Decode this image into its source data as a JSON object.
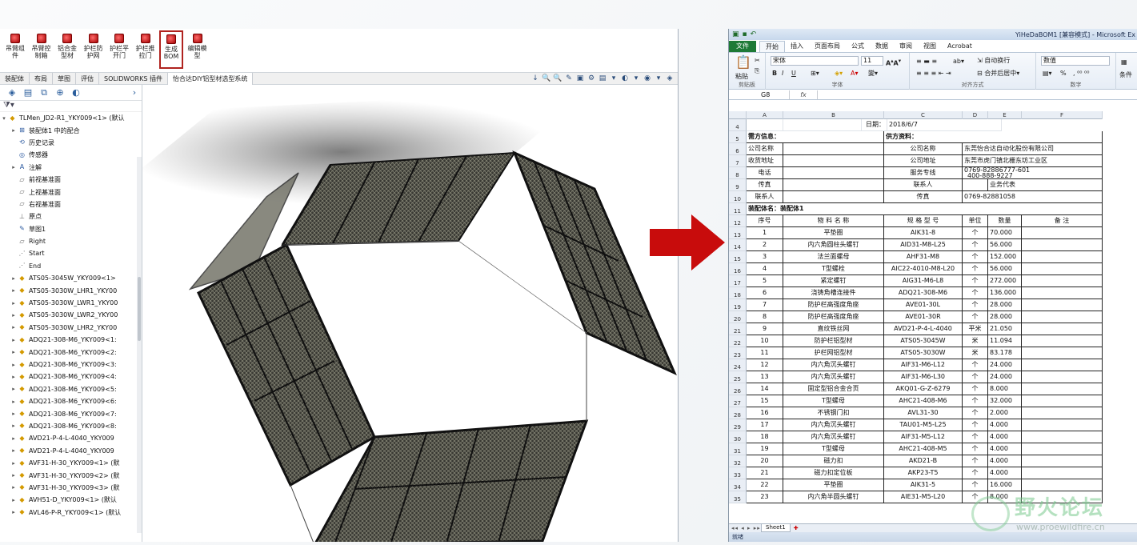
{
  "solidworks": {
    "commands": [
      {
        "label": "吊臂组件",
        "active": false
      },
      {
        "label": "吊臂控制箱",
        "active": false
      },
      {
        "label": "铝合金型材",
        "active": false
      },
      {
        "label": "护栏防护网",
        "active": false
      },
      {
        "label": "护栏平开门",
        "active": false
      },
      {
        "label": "护栏推拉门",
        "active": false
      },
      {
        "label": "生成BOM",
        "active": true
      },
      {
        "label": "编辑模型",
        "active": false
      }
    ],
    "tabs": [
      "装配体",
      "布局",
      "草图",
      "评估",
      "SOLIDWORKS 插件",
      "怡合达DIY铝型材选型系统"
    ],
    "active_tab": "怡合达DIY铝型材选型系统",
    "view_tools": [
      "↓",
      "🔍",
      "🔍",
      "✎",
      "▣",
      "⚙",
      "▤",
      "▾",
      "◐",
      "▾",
      "◉",
      "▾",
      "◈"
    ],
    "tree_tabs": [
      "assembly-icon",
      "property-icon",
      "config-icon",
      "target-icon",
      "display-icon"
    ],
    "tree": [
      {
        "label": "TLMen_JD2-R1_YKY009<1> (默认",
        "icon": "assembly",
        "arrow": "▾"
      },
      {
        "label": "装配体1 中的配合",
        "icon": "mates",
        "arrow": "▸"
      },
      {
        "label": "历史记录",
        "icon": "history",
        "arrow": ""
      },
      {
        "label": "传感器",
        "icon": "sensor",
        "arrow": ""
      },
      {
        "label": "注解",
        "icon": "annotation",
        "arrow": "▸"
      },
      {
        "label": "前视基准面",
        "icon": "plane",
        "arrow": ""
      },
      {
        "label": "上视基准面",
        "icon": "plane",
        "arrow": ""
      },
      {
        "label": "右视基准面",
        "icon": "plane",
        "arrow": ""
      },
      {
        "label": "原点",
        "icon": "origin",
        "arrow": ""
      },
      {
        "label": "草图1",
        "icon": "sketch",
        "arrow": ""
      },
      {
        "label": "Right",
        "icon": "plane",
        "arrow": ""
      },
      {
        "label": "Start",
        "icon": "point",
        "arrow": ""
      },
      {
        "label": "End",
        "icon": "point",
        "arrow": ""
      },
      {
        "label": "ATS05-3045W_YKY009<1>",
        "icon": "part",
        "arrow": "▸"
      },
      {
        "label": "ATS05-3030W_LHR1_YKY00",
        "icon": "part",
        "arrow": "▸"
      },
      {
        "label": "ATS05-3030W_LWR1_YKY00",
        "icon": "part",
        "arrow": "▸"
      },
      {
        "label": "ATS05-3030W_LWR2_YKY00",
        "icon": "part",
        "arrow": "▸"
      },
      {
        "label": "ATS05-3030W_LHR2_YKY00",
        "icon": "part",
        "arrow": "▸"
      },
      {
        "label": "ADQ21-308-M6_YKY009<1:",
        "icon": "part",
        "arrow": "▸"
      },
      {
        "label": "ADQ21-308-M6_YKY009<2:",
        "icon": "part",
        "arrow": "▸"
      },
      {
        "label": "ADQ21-308-M6_YKY009<3:",
        "icon": "part",
        "arrow": "▸"
      },
      {
        "label": "ADQ21-308-M6_YKY009<4:",
        "icon": "part",
        "arrow": "▸"
      },
      {
        "label": "ADQ21-308-M6_YKY009<5:",
        "icon": "part",
        "arrow": "▸"
      },
      {
        "label": "ADQ21-308-M6_YKY009<6:",
        "icon": "part",
        "arrow": "▸"
      },
      {
        "label": "ADQ21-308-M6_YKY009<7:",
        "icon": "part",
        "arrow": "▸"
      },
      {
        "label": "ADQ21-308-M6_YKY009<8:",
        "icon": "part",
        "arrow": "▸"
      },
      {
        "label": "AVD21-P-4-L-4040_YKY009",
        "icon": "part",
        "arrow": "▸"
      },
      {
        "label": "AVD21-P-4-L-4040_YKY009",
        "icon": "part",
        "arrow": "▸"
      },
      {
        "label": "AVF31-H-30_YKY009<1> (默",
        "icon": "assembly",
        "arrow": "▸"
      },
      {
        "label": "AVF31-H-30_YKY009<2> (默",
        "icon": "assembly",
        "arrow": "▸"
      },
      {
        "label": "AVF31-H-30_YKY009<3> (默",
        "icon": "assembly",
        "arrow": "▸"
      },
      {
        "label": "AVH51-D_YKY009<1> (默认",
        "icon": "assembly",
        "arrow": "▸"
      },
      {
        "label": "AVL46-P-R_YKY009<1> (默认",
        "icon": "part",
        "arrow": "▸"
      }
    ]
  },
  "excel": {
    "title": "YiHeDaBOM1 [兼容模式] - Microsoft Ex",
    "menu": [
      "文件",
      "开始",
      "插入",
      "页面布局",
      "公式",
      "数据",
      "审阅",
      "视图",
      "Acrobat"
    ],
    "active_menu": "开始",
    "ribbon": {
      "paste": "粘贴",
      "clipboard": "剪贴板",
      "font_name": "宋体",
      "font_size": "11",
      "font_group": "字体",
      "wrap": "自动换行",
      "merge": "合并后居中",
      "align_group": "对齐方式",
      "number_format": "数值",
      "number_group": "数字",
      "bold": "B",
      "italic": "I",
      "underline": "U",
      "percent": "%",
      "more": "条件"
    },
    "name_box": "G8",
    "fx": "fx",
    "columns": [
      "A",
      "B",
      "C",
      "D",
      "E",
      "F"
    ],
    "header_rows": [
      {
        "row": "4",
        "cells": [
          "",
          "",
          "",
          "日期：",
          "2018/6/7",
          ""
        ]
      },
      {
        "row": "5",
        "cells": [
          "需方信息：",
          "",
          "供方资料：",
          "",
          "",
          ""
        ]
      },
      {
        "row": "6",
        "cells": [
          "公司名称",
          "",
          "公司名称",
          "东莞怡合达自动化股份有限公司",
          "",
          ""
        ]
      },
      {
        "row": "7",
        "cells": [
          "收货地址",
          "",
          "公司地址",
          "东莞市虎门镇北栅东坊工业区",
          "",
          ""
        ]
      },
      {
        "row": "8",
        "cells": [
          "电话",
          "",
          "服务专线",
          "0769-82886777-601",
          "400-888-9227",
          ""
        ]
      },
      {
        "row": "9",
        "cells": [
          "传真",
          "",
          "联系人",
          "",
          "业务代表",
          ""
        ]
      },
      {
        "row": "10",
        "cells": [
          "联系人",
          "",
          "传真",
          "0769-82881058",
          "",
          ""
        ]
      },
      {
        "row": "11",
        "cells": [
          "装配体名：装配体1",
          "",
          "",
          "",
          "",
          ""
        ]
      }
    ],
    "table_header": {
      "row": "12",
      "cells": [
        "序号",
        "物 料 名 称",
        "规 格 型 号",
        "单位",
        "数量",
        "备    注"
      ]
    },
    "bom_rows": [
      {
        "row": "13",
        "cells": [
          "1",
          "平垫圈",
          "AIK31-8",
          "个",
          "70.000",
          ""
        ]
      },
      {
        "row": "14",
        "cells": [
          "2",
          "内六角圆柱头螺钉",
          "AID31-M8-L25",
          "个",
          "56.000",
          ""
        ]
      },
      {
        "row": "15",
        "cells": [
          "3",
          "法兰面螺母",
          "AHF31-M8",
          "个",
          "152.000",
          ""
        ]
      },
      {
        "row": "16",
        "cells": [
          "4",
          "T型螺栓",
          "AIC22-4010-M8-L20",
          "个",
          "56.000",
          ""
        ]
      },
      {
        "row": "17",
        "cells": [
          "5",
          "紧定螺钉",
          "AIG31-M6-L8",
          "个",
          "272.000",
          ""
        ]
      },
      {
        "row": "18",
        "cells": [
          "6",
          "浇铸角槽连接件",
          "ADQ21-308-M6",
          "个",
          "136.000",
          ""
        ]
      },
      {
        "row": "19",
        "cells": [
          "7",
          "防护栏高强度角座",
          "AVE01-30L",
          "个",
          "28.000",
          ""
        ]
      },
      {
        "row": "20",
        "cells": [
          "8",
          "防护栏高强度角座",
          "AVE01-30R",
          "个",
          "28.000",
          ""
        ]
      },
      {
        "row": "21",
        "cells": [
          "9",
          "直纹铁丝网",
          "AVD21-P-4-L-4040",
          "平米",
          "21.050",
          ""
        ]
      },
      {
        "row": "22",
        "cells": [
          "10",
          "防护栏铝型材",
          "ATS05-3045W",
          "米",
          "11.094",
          ""
        ]
      },
      {
        "row": "23",
        "cells": [
          "11",
          "护栏网铝型材",
          "ATS05-3030W",
          "米",
          "83.178",
          ""
        ]
      },
      {
        "row": "24",
        "cells": [
          "12",
          "内六角沉头螺钉",
          "AIF31-M6-L12",
          "个",
          "24.000",
          ""
        ]
      },
      {
        "row": "25",
        "cells": [
          "13",
          "内六角沉头螺钉",
          "AIF31-M6-L30",
          "个",
          "24.000",
          ""
        ]
      },
      {
        "row": "26",
        "cells": [
          "14",
          "固定型铝合金合页",
          "AKQ01-G-Z-6279",
          "个",
          "8.000",
          ""
        ]
      },
      {
        "row": "27",
        "cells": [
          "15",
          "T型螺母",
          "AHC21-408-M6",
          "个",
          "32.000",
          ""
        ]
      },
      {
        "row": "28",
        "cells": [
          "16",
          "不锈钢门扣",
          "AVL31-30",
          "个",
          "2.000",
          ""
        ]
      },
      {
        "row": "29",
        "cells": [
          "17",
          "内六角沉头螺钉",
          "TAU01-M5-L25",
          "个",
          "4.000",
          ""
        ]
      },
      {
        "row": "30",
        "cells": [
          "18",
          "内六角沉头螺钉",
          "AIF31-M5-L12",
          "个",
          "4.000",
          ""
        ]
      },
      {
        "row": "31",
        "cells": [
          "19",
          "T型螺母",
          "AHC21-408-M5",
          "个",
          "4.000",
          ""
        ]
      },
      {
        "row": "32",
        "cells": [
          "20",
          "磁力扣",
          "AKD21-B",
          "个",
          "4.000",
          ""
        ]
      },
      {
        "row": "33",
        "cells": [
          "21",
          "磁力扣定位板",
          "AKP23-T5",
          "个",
          "4.000",
          ""
        ]
      },
      {
        "row": "34",
        "cells": [
          "22",
          "平垫圈",
          "AIK31-5",
          "个",
          "16.000",
          ""
        ]
      },
      {
        "row": "35",
        "cells": [
          "23",
          "内六角半圆头螺钉",
          "AIE31-M5-L20",
          "个",
          "8.000",
          ""
        ]
      }
    ],
    "sheet_nav": "◂◂ ◂ ▸ ▸▸",
    "sheet_tab": "Sheet1",
    "status": "就绪"
  },
  "watermark": {
    "text": "野火论坛",
    "url": "www.proewildfire.cn"
  },
  "colors": {
    "arrow": "#c80c0c",
    "excel_green": "#1e7a36",
    "highlight": "#b0231f"
  }
}
